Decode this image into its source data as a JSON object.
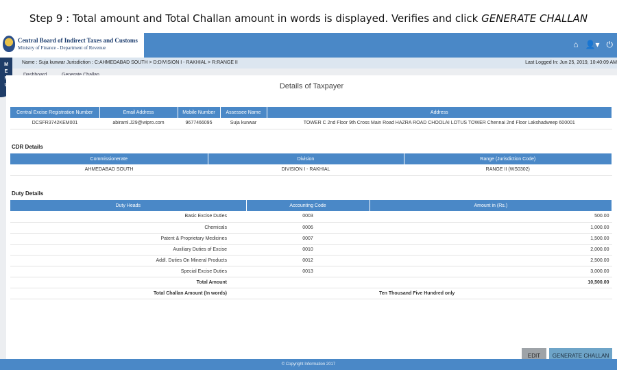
{
  "caption": {
    "prefix": "Step 9 : Total amount and  Total Challan amount in  words is displayed.  Verifies and click ",
    "action": "GENERATE CHALLAN"
  },
  "header": {
    "org_name": "Central Board of Indirect Taxes and Customs",
    "org_sub": "Ministry of Finance - Department of Revenue",
    "icons": [
      "home-icon",
      "user-icon",
      "power-icon"
    ]
  },
  "menu_label": [
    "M",
    "E",
    "N",
    "U"
  ],
  "infobar": {
    "left": "Name : Suja kunwar   Jurisdiction : C:AHMEDABAD SOUTH > D:DIVISION I - RAKHIAL > R:RANGE II",
    "right": "Last Logged In: Jun 25, 2019, 10:40:09 AM"
  },
  "breadcrumb": {
    "home": "Dashboard",
    "current": "Generate Challan"
  },
  "page_title": "Details of Taxpayer",
  "taxpayer": {
    "headers": [
      "Central Excise Registration Number",
      "Email Address",
      "Mobile Number",
      "Assessee Name",
      "Address"
    ],
    "row": [
      "DCSFR3742KEM001",
      "abiraml.J29@wipro.com",
      "9677466095",
      "Suja kunwar",
      "TOWER C 2nd Floor 9th Cross Main Road HAZRA ROAD CHOOLAI LOTUS TOWER Chennai 2nd Floor Lakshadweep 600001"
    ]
  },
  "cdr": {
    "label": "CDR Details",
    "headers": [
      "Commissionerate",
      "Division",
      "Range (Jurisdiction Code)"
    ],
    "row": [
      "AHMEDABAD SOUTH",
      "DIVISION I - RAKHIAL",
      "RANGE II (WS0302)"
    ]
  },
  "duty": {
    "label": "Duty Details",
    "headers": [
      "Duty Heads",
      "Accounting Code",
      "Amount in (Rs.)"
    ],
    "rows": [
      {
        "head": "Basic Excise Duties",
        "code": "0003",
        "amount": "500.00"
      },
      {
        "head": "Chemicals",
        "code": "0006",
        "amount": "1,000.00"
      },
      {
        "head": "Patent & Proprietary Medicines",
        "code": "0007",
        "amount": "1,500.00"
      },
      {
        "head": "Auxiliary Duties of Excise",
        "code": "0010",
        "amount": "2,000.00"
      },
      {
        "head": "Addl. Duties On Mineral Products",
        "code": "0012",
        "amount": "2,500.00"
      },
      {
        "head": "Special Excise Duties",
        "code": "0013",
        "amount": "3,000.00"
      }
    ],
    "total_label": "Total Amount",
    "total_value": "10,500.00",
    "words_label": "Total Challan Amount (In words)",
    "words_value": "Ten Thousand Five Hundred only"
  },
  "buttons": {
    "edit": "EDIT",
    "generate": "GENERATE CHALLAN"
  },
  "footer": "© Copyright Information 2017"
}
